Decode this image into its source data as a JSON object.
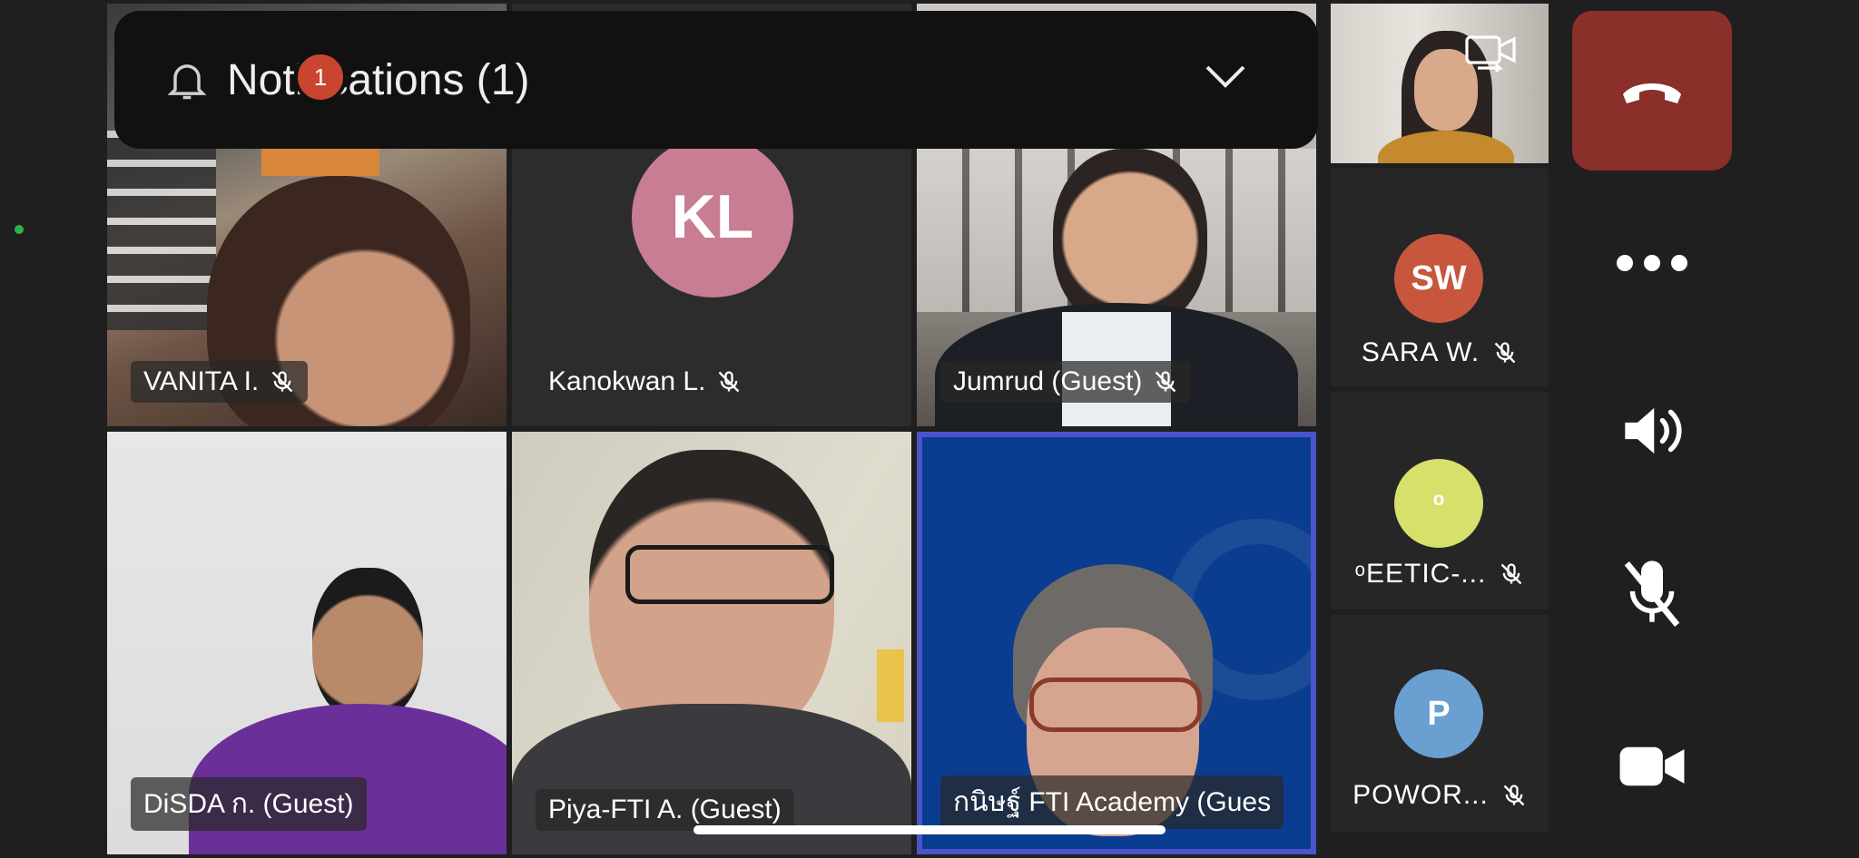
{
  "notification": {
    "title": "Notifications (1)",
    "badge_count": "1"
  },
  "grid_participants": [
    {
      "name": "VANITA I."
    },
    {
      "name": "Kanokwan L.",
      "initials": "KL"
    },
    {
      "name": "Jumrud (Guest)"
    },
    {
      "name": "DiSDA ก. (Guest)"
    },
    {
      "name": "Piya-FTI A. (Guest)"
    },
    {
      "name": "กนิษฐ์ FTI Academy (Gues"
    }
  ],
  "side_participants": [
    {
      "name": "SARA W.",
      "initials": "SW",
      "color": "#c7563c"
    },
    {
      "name": "ᵒEETIC-...",
      "initials": "ᵒ",
      "color": "#d6e06b"
    },
    {
      "name": "POWOR...",
      "initials": "P",
      "color": "#6a9fd2"
    }
  ],
  "colors": {
    "kl_avatar": "#c87d92",
    "end_call": "#8b2f2a",
    "active_border": "#4a55c9"
  }
}
